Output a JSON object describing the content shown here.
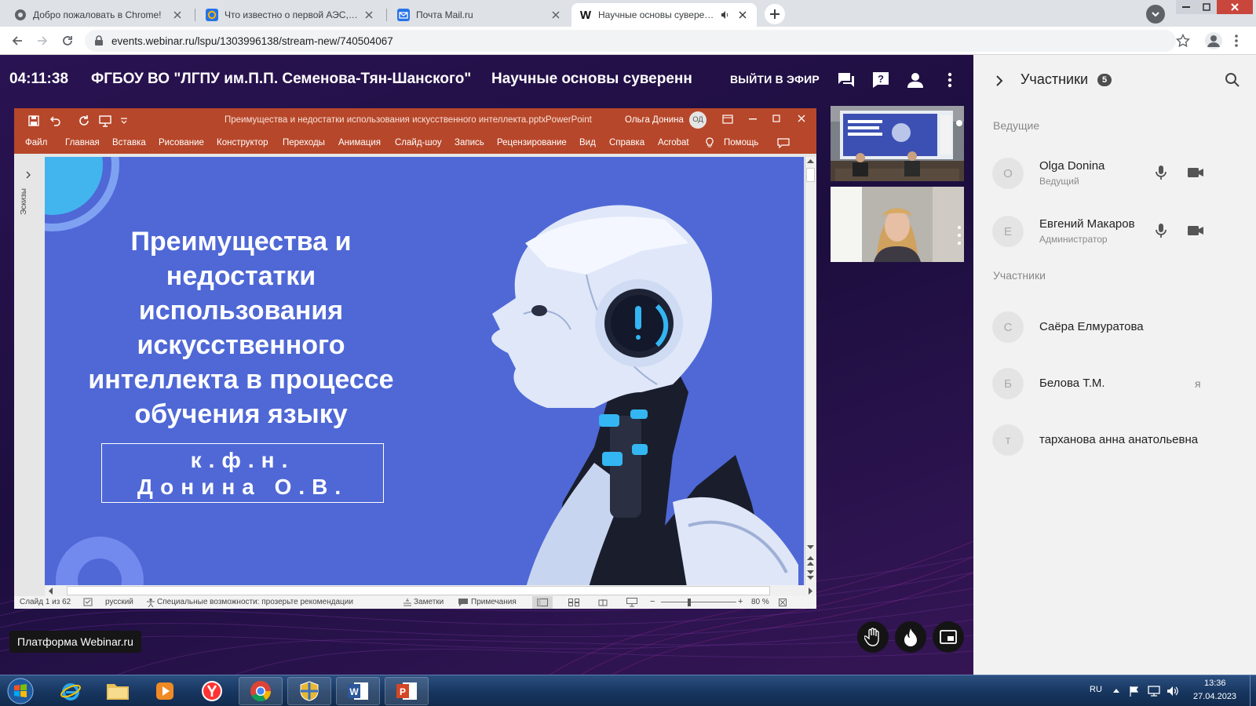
{
  "browser": {
    "tabs": [
      {
        "title": "Добро пожаловать в Chrome!",
        "icon": "chrome-icon"
      },
      {
        "title": "Что известно о первой АЭС, котор",
        "icon": "mail-at-icon"
      },
      {
        "title": "Почта Mail.ru",
        "icon": "mail-envelope-icon"
      },
      {
        "title": "Научные основы суверенн",
        "icon": "webinar-w-icon",
        "active": true
      }
    ],
    "url": "events.webinar.ru/lspu/1303996138/stream-new/740504067"
  },
  "webinar": {
    "timer": "04:11:38",
    "org": "ФГБОУ ВО \"ЛГПУ им.П.П. Семенова-Тян-Шанского\"",
    "event_title": "Научные основы суверенн",
    "go_live": "ВЫЙТИ В ЭФИР",
    "platform_label": "Платформа Webinar.ru"
  },
  "powerpoint": {
    "filename": "Преимущества и недостатки использования искусственного интеллекта.pptx",
    "app": "PowerPoint",
    "user": "Ольга Донина",
    "user_initials": "ОД",
    "ribbon": [
      "Файл",
      "Главная",
      "Вставка",
      "Рисование",
      "Конструктор",
      "Переходы",
      "Анимация",
      "Слайд-шоу",
      "Запись",
      "Рецензирование",
      "Вид",
      "Справка",
      "Acrobat"
    ],
    "help": "Помощь",
    "thumbnails_label": "Эскизы",
    "slide": {
      "title": "Преимущества и недостатки использования искусственного интеллекта в процессе обучения языку",
      "author_line1": "к.ф.н.",
      "author_line2": "Донина О.В."
    },
    "status": {
      "slide_counter": "Слайд 1 из 62",
      "language": "русский",
      "accessibility": "Специальные возможности: прозерьте рекомендации",
      "notes": "Заметки",
      "comments": "Примечания",
      "zoom": "80 %"
    }
  },
  "participants": {
    "title": "Участники",
    "count": "5",
    "hosts_label": "Ведущие",
    "attendees_label": "Участники",
    "hosts": [
      {
        "initial": "O",
        "name": "Olga Donina",
        "role": "Ведущий"
      },
      {
        "initial": "Е",
        "name": "Евгений Макаров",
        "role": "Администратор"
      }
    ],
    "attendees": [
      {
        "initial": "С",
        "name": "Саёра Елмуратова",
        "extra": ""
      },
      {
        "initial": "Б",
        "name": "Белова Т.М.",
        "extra": "я"
      },
      {
        "initial": "т",
        "name": "тарханова анна анатольевна",
        "extra": ""
      }
    ]
  },
  "taskbar": {
    "lang": "RU",
    "time": "13:36",
    "date": "27.04.2023"
  }
}
